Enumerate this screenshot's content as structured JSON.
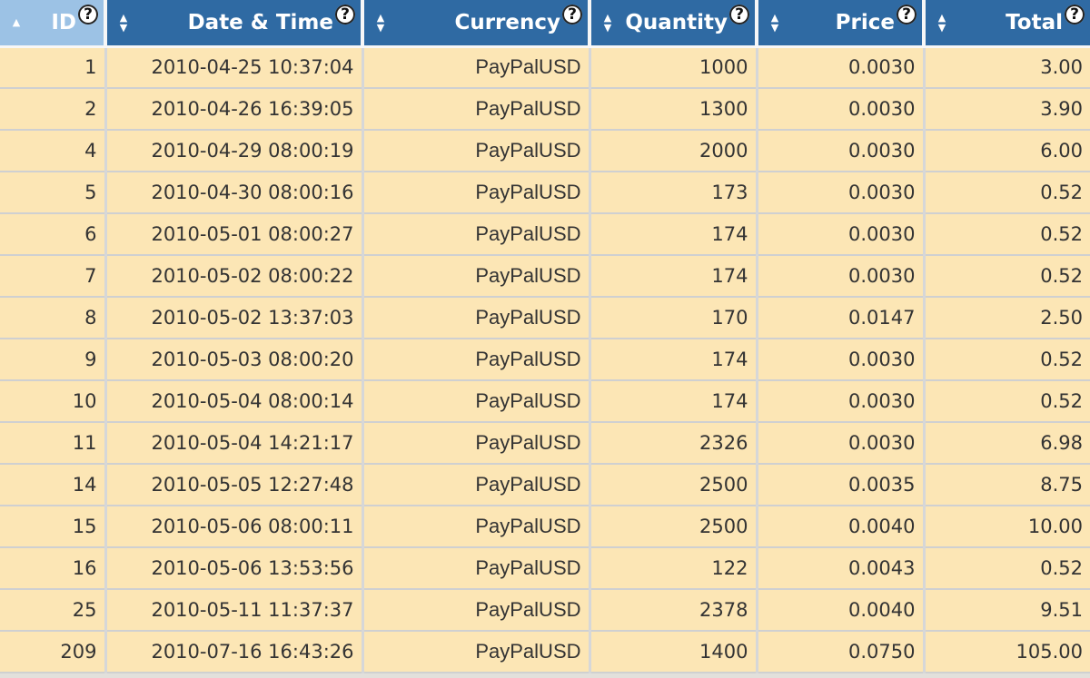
{
  "table": {
    "columns": [
      {
        "label": "ID",
        "sort": "ascending",
        "sort_icon": "sort-ascending-icon",
        "help_icon": "help-icon"
      },
      {
        "label": "Date & Time",
        "sort": "none",
        "sort_icon": "sort-both-icon",
        "help_icon": "help-icon"
      },
      {
        "label": "Currency",
        "sort": "none",
        "sort_icon": "sort-both-icon",
        "help_icon": "help-icon"
      },
      {
        "label": "Quantity",
        "sort": "none",
        "sort_icon": "sort-both-icon",
        "help_icon": "help-icon"
      },
      {
        "label": "Price",
        "sort": "none",
        "sort_icon": "sort-both-icon",
        "help_icon": "help-icon"
      },
      {
        "label": "Total",
        "sort": "none",
        "sort_icon": "sort-both-icon",
        "help_icon": "help-icon"
      }
    ],
    "rows": [
      [
        "1",
        "2010-04-25 10:37:04",
        "PayPalUSD",
        "1000",
        "0.0030",
        "3.00"
      ],
      [
        "2",
        "2010-04-26 16:39:05",
        "PayPalUSD",
        "1300",
        "0.0030",
        "3.90"
      ],
      [
        "4",
        "2010-04-29 08:00:19",
        "PayPalUSD",
        "2000",
        "0.0030",
        "6.00"
      ],
      [
        "5",
        "2010-04-30 08:00:16",
        "PayPalUSD",
        "173",
        "0.0030",
        "0.52"
      ],
      [
        "6",
        "2010-05-01 08:00:27",
        "PayPalUSD",
        "174",
        "0.0030",
        "0.52"
      ],
      [
        "7",
        "2010-05-02 08:00:22",
        "PayPalUSD",
        "174",
        "0.0030",
        "0.52"
      ],
      [
        "8",
        "2010-05-02 13:37:03",
        "PayPalUSD",
        "170",
        "0.0147",
        "2.50"
      ],
      [
        "9",
        "2010-05-03 08:00:20",
        "PayPalUSD",
        "174",
        "0.0030",
        "0.52"
      ],
      [
        "10",
        "2010-05-04 08:00:14",
        "PayPalUSD",
        "174",
        "0.0030",
        "0.52"
      ],
      [
        "11",
        "2010-05-04 14:21:17",
        "PayPalUSD",
        "2326",
        "0.0030",
        "6.98"
      ],
      [
        "14",
        "2010-05-05 12:27:48",
        "PayPalUSD",
        "2500",
        "0.0035",
        "8.75"
      ],
      [
        "15",
        "2010-05-06 08:00:11",
        "PayPalUSD",
        "2500",
        "0.0040",
        "10.00"
      ],
      [
        "16",
        "2010-05-06 13:53:56",
        "PayPalUSD",
        "122",
        "0.0043",
        "0.52"
      ],
      [
        "25",
        "2010-05-11 11:37:37",
        "PayPalUSD",
        "2378",
        "0.0040",
        "9.51"
      ],
      [
        "209",
        "2010-07-16 16:43:26",
        "PayPalUSD",
        "1400",
        "0.0750",
        "105.00"
      ]
    ]
  },
  "colors": {
    "header_bg": "#2f6aa3",
    "header_sorted_bg": "#9cc2e5",
    "row_bg": "#fce6b5",
    "grid_line": "#d6d7d8"
  }
}
